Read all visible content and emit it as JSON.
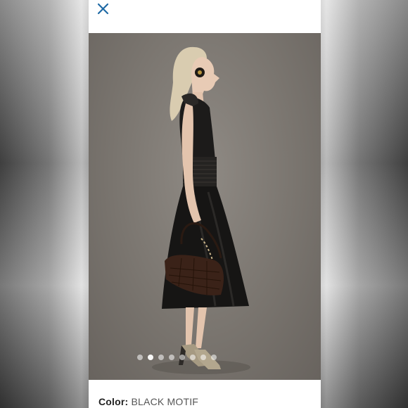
{
  "viewer": {
    "close_icon": "close-icon",
    "accent_color": "#1f6aa5"
  },
  "gallery": {
    "image_count": 8,
    "active_index": 1
  },
  "details": {
    "color_label": "Color:",
    "color_value": "BLACK MOTIF"
  }
}
